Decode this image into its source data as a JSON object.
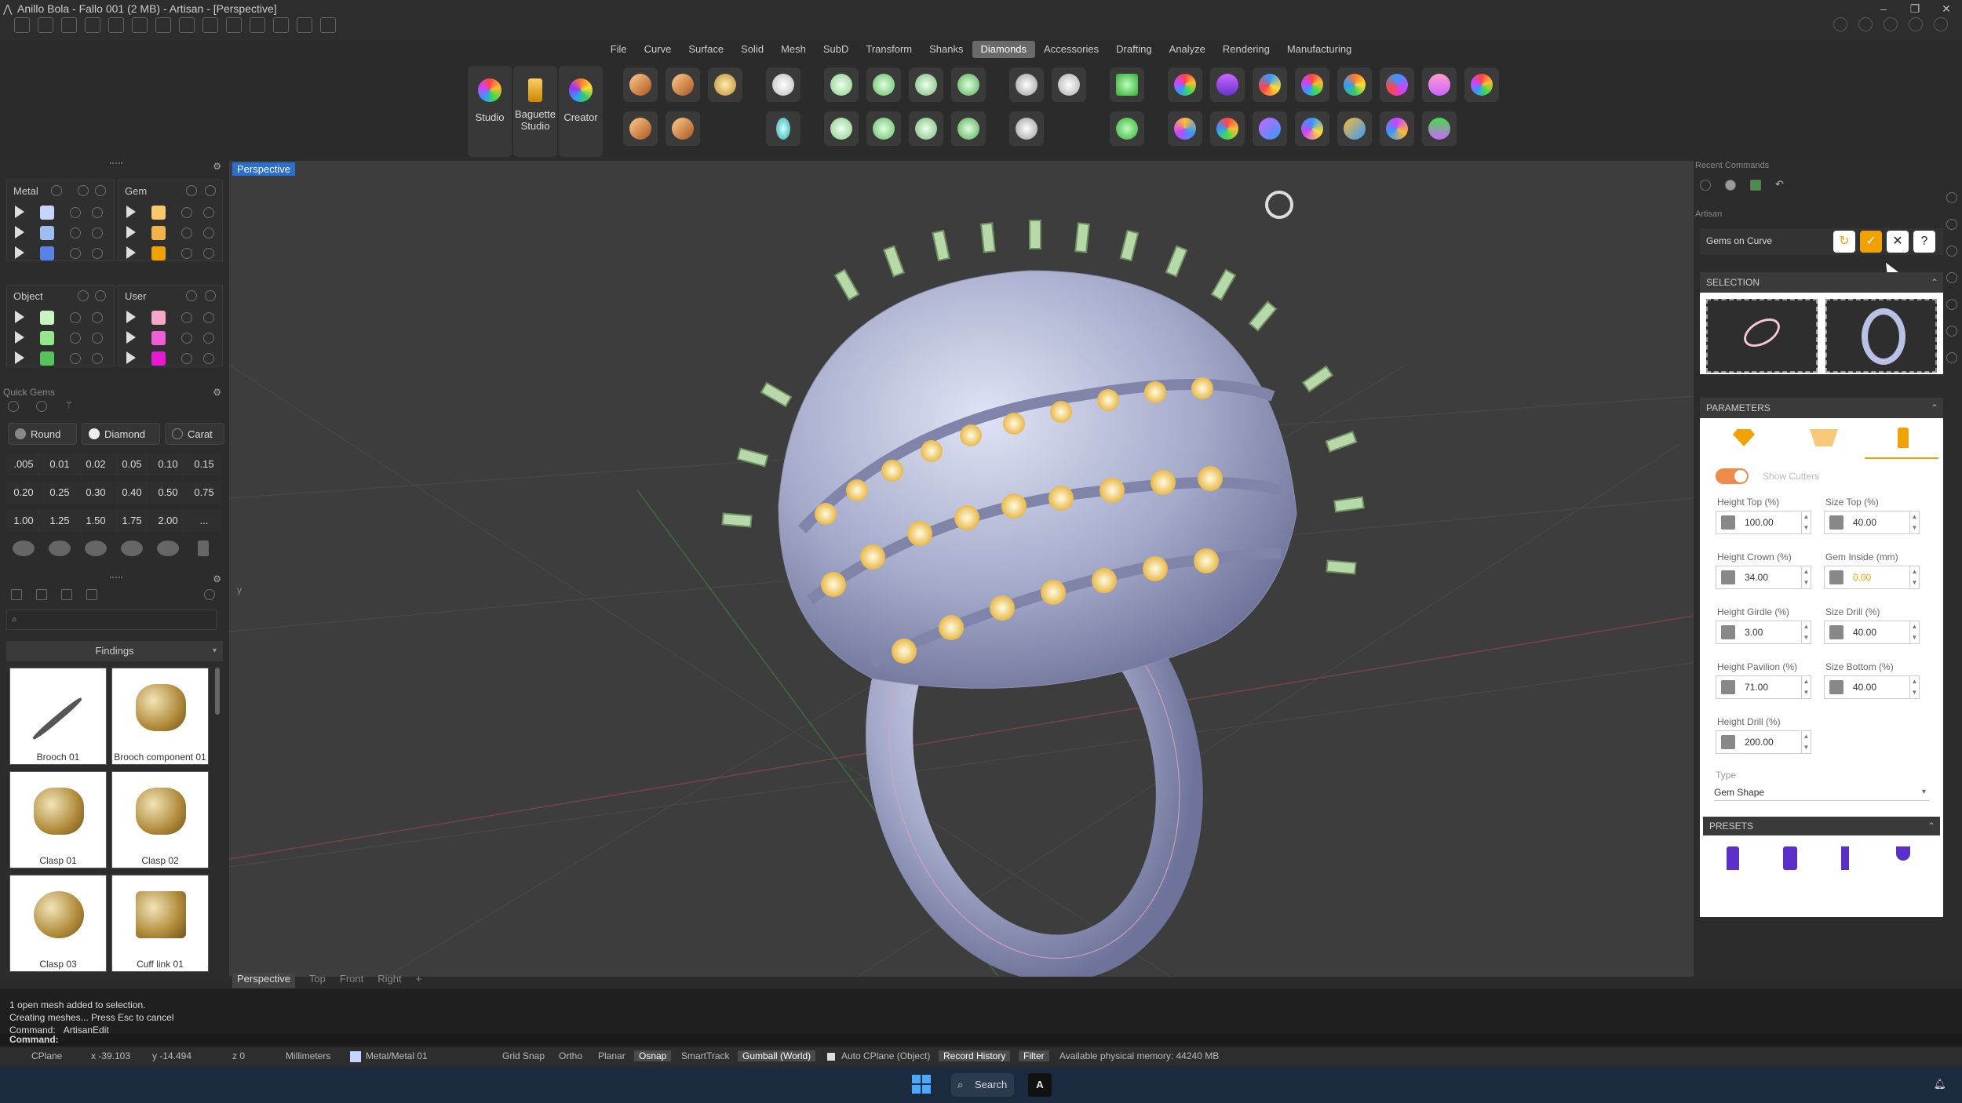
{
  "window": {
    "title": "Anillo Bola - Fallo 001 (2 MB) - Artisan - [Perspective]",
    "buttons": [
      "–",
      "❐",
      "✕"
    ]
  },
  "menu": {
    "items": [
      "File",
      "Curve",
      "Surface",
      "Solid",
      "Mesh",
      "SubD",
      "Transform",
      "Shanks",
      "Diamonds",
      "Accessories",
      "Drafting",
      "Analyze",
      "Rendering",
      "Manufacturing"
    ],
    "active": "Diamonds"
  },
  "toolbar": {
    "studio": "Studio",
    "baguette": "Baguette\nStudio",
    "creator": "Creator"
  },
  "left": {
    "metal": {
      "label": "Metal",
      "colors": [
        "#c6d5ff",
        "#9fbcf1",
        "#5a82e6"
      ]
    },
    "gem": {
      "label": "Gem",
      "colors": [
        "#f9c86a",
        "#f4b24a",
        "#f0a300"
      ]
    },
    "object": {
      "label": "Object",
      "colors": [
        "#c9f5c2",
        "#92e88a",
        "#55c55a"
      ]
    },
    "user": {
      "label": "User",
      "colors": [
        "#f5a6c9",
        "#ee5fd6",
        "#e61bd1"
      ]
    },
    "quickgems": {
      "title": "Quick Gems",
      "shape": "Round",
      "material": "Diamond",
      "unit": "Carat",
      "sizes": [
        [
          ".005",
          "0.01",
          "0.02",
          "0.05",
          "0.10",
          "0.15"
        ],
        [
          "0.20",
          "0.25",
          "0.30",
          "0.40",
          "0.50",
          "0.75"
        ],
        [
          "1.00",
          "1.25",
          "1.50",
          "1.75",
          "2.00",
          "..."
        ]
      ]
    },
    "library": {
      "category": "Findings",
      "items": [
        "Brooch 01",
        "Brooch component 01",
        "Clasp 01",
        "Clasp 02",
        "Clasp 03",
        "Cuff link 01"
      ]
    }
  },
  "viewport": {
    "label": "Perspective",
    "tabs": [
      "Perspective",
      "Top",
      "Front",
      "Right",
      "+"
    ],
    "axis_y": "y"
  },
  "right": {
    "recent": "Recent Commands",
    "artisan": "Artisan",
    "command": "Gems on Curve",
    "selection": "SELECTION",
    "parameters": "PARAMETERS",
    "show_cutters": "Show Cutters",
    "fields": [
      {
        "label": "Height Top (%)",
        "value": "100.00"
      },
      {
        "label": "Size Top (%)",
        "value": "40.00"
      },
      {
        "label": "Height Crown (%)",
        "value": "34.00"
      },
      {
        "label": "Gem Inside (mm)",
        "value": "0.00"
      },
      {
        "label": "Height Girdle (%)",
        "value": "3.00"
      },
      {
        "label": "Size Drill (%)",
        "value": "40.00"
      },
      {
        "label": "Height Pavilion (%)",
        "value": "71.00"
      },
      {
        "label": "Size Bottom (%)",
        "value": "40.00"
      },
      {
        "label": "Height Drill (%)",
        "value": "200.00"
      }
    ],
    "type_label": "Type",
    "type_value": "Gem Shape",
    "presets": "PRESETS"
  },
  "console": {
    "lines": [
      "1 open mesh added to selection.",
      "Creating meshes... Press Esc to cancel",
      "Command: _ArtisanEdit"
    ],
    "prompt": "Command:"
  },
  "status": {
    "cplane": "CPlane",
    "x": "x -39.103",
    "y": "y -14.494",
    "z": "z 0",
    "units": "Millimeters",
    "layer": "Metal/Metal 01",
    "toggles": [
      "Grid Snap",
      "Ortho",
      "Planar",
      "Osnap",
      "SmartTrack",
      "Gumball (World)"
    ],
    "autocplane": "Auto CPlane (Object)",
    "record": "Record History",
    "filter": "Filter",
    "memory": "Available physical memory: 44240 MB"
  },
  "taskbar": {
    "search": "Search",
    "app": "A"
  }
}
